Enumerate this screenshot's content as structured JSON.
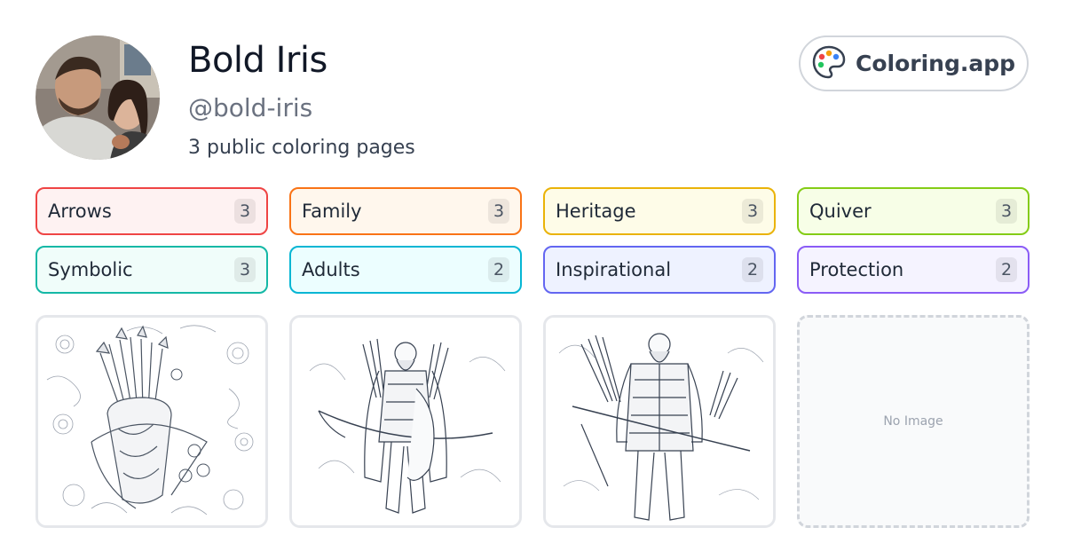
{
  "profile": {
    "name": "Bold Iris",
    "handle": "@bold-iris",
    "page_count_text": "3 public coloring pages"
  },
  "brand": {
    "label": "Coloring.app",
    "icon": "palette-icon"
  },
  "tags": [
    {
      "label": "Arrows",
      "count": "3",
      "border": "#ef4444",
      "bg": "#fef2f2"
    },
    {
      "label": "Family",
      "count": "3",
      "border": "#f97316",
      "bg": "#fff7ed"
    },
    {
      "label": "Heritage",
      "count": "3",
      "border": "#eab308",
      "bg": "#fefce8"
    },
    {
      "label": "Quiver",
      "count": "3",
      "border": "#84cc16",
      "bg": "#f7fee7"
    },
    {
      "label": "Symbolic",
      "count": "3",
      "border": "#14b8a6",
      "bg": "#f0fdfa"
    },
    {
      "label": "Adults",
      "count": "2",
      "border": "#06b6d4",
      "bg": "#ecfeff"
    },
    {
      "label": "Inspirational",
      "count": "2",
      "border": "#6366f1",
      "bg": "#eef2ff"
    },
    {
      "label": "Protection",
      "count": "2",
      "border": "#8b5cf6",
      "bg": "#f5f3ff"
    }
  ],
  "cards": [
    {
      "kind": "image",
      "subject": "quiver with arrows, bow and floral pattern"
    },
    {
      "kind": "image",
      "subject": "archer warrior with quiver and bow"
    },
    {
      "kind": "image",
      "subject": "armored archer warrior with bow"
    },
    {
      "kind": "empty",
      "placeholder": "No Image"
    }
  ]
}
